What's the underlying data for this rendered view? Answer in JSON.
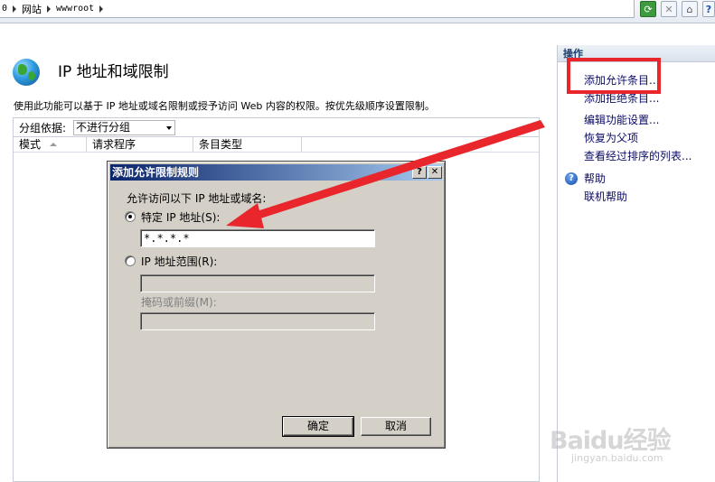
{
  "addressbar": {
    "crumbs": [
      "0",
      "网站",
      "wwwroot"
    ]
  },
  "page": {
    "title": "IP 地址和域限制",
    "description": "使用此功能可以基于 IP 地址或域名限制或授予访问 Web 内容的权限。按优先级顺序设置限制。",
    "group_label": "分组依据:",
    "group_value": "不进行分组",
    "columns": [
      "模式",
      "请求程序",
      "条目类型"
    ]
  },
  "actions": {
    "header": "操作",
    "items": [
      "添加允许条目...",
      "添加拒绝条目...",
      "编辑功能设置...",
      "恢复为父项",
      "查看经过排序的列表...",
      "帮助",
      "联机帮助"
    ]
  },
  "dialog": {
    "title": "添加允许限制规则",
    "help_btn": "?",
    "close_btn": "✕",
    "prompt": "允许访问以下 IP 地址或域名:",
    "specific_label": "特定 IP 地址(S):",
    "specific_value": "*.*.*.*",
    "range_label": "IP 地址范围(R):",
    "mask_label": "掩码或前缀(M):",
    "ok": "确定",
    "cancel": "取消"
  },
  "watermark": {
    "logo": "Baidu经验",
    "url": "jingyan.baidu.com"
  },
  "colors": {
    "annotation": "#e8262b",
    "dialog_title": "#0a246a"
  }
}
